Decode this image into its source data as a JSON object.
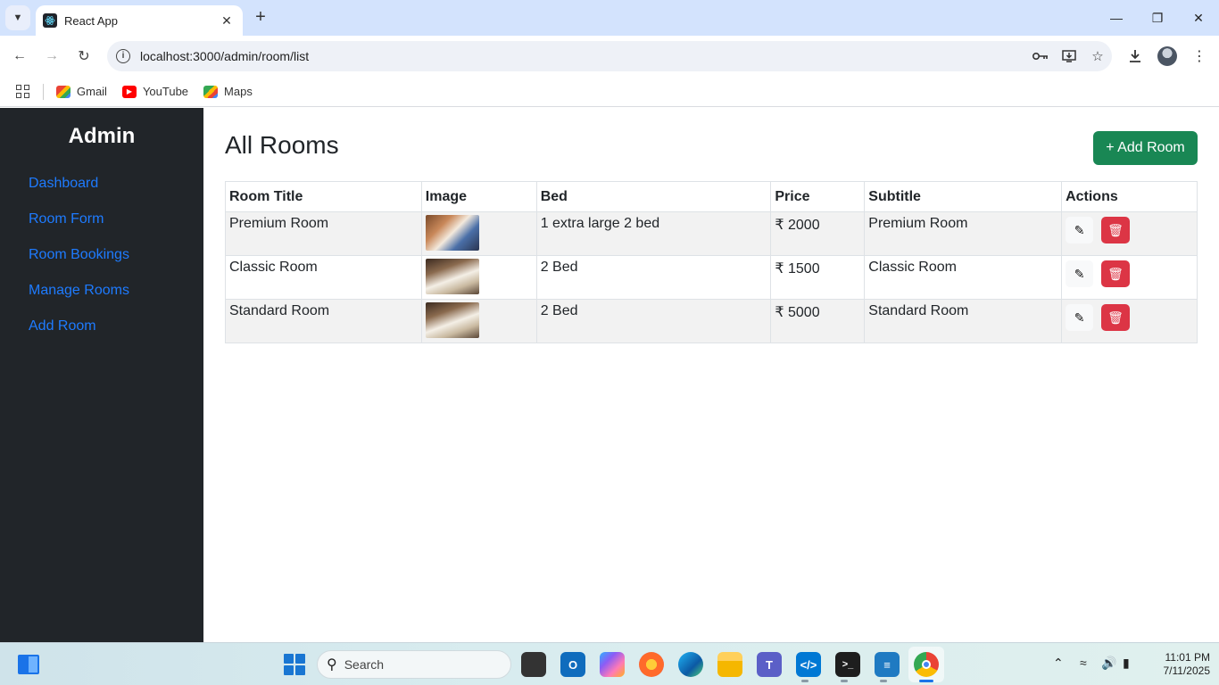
{
  "browser": {
    "tab_title": "React App",
    "url": "localhost:3000/admin/room/list",
    "bookmarks": [
      {
        "label": "Gmail",
        "icon": "gmail-icon",
        "color": "#ea4335"
      },
      {
        "label": "YouTube",
        "icon": "youtube-icon",
        "color": "#ff0000"
      },
      {
        "label": "Maps",
        "icon": "maps-icon",
        "color": "#34a853"
      }
    ]
  },
  "sidebar": {
    "title": "Admin",
    "items": [
      {
        "label": "Dashboard"
      },
      {
        "label": "Room Form"
      },
      {
        "label": "Room Bookings"
      },
      {
        "label": "Manage Rooms"
      },
      {
        "label": "Add Room"
      }
    ]
  },
  "main": {
    "heading": "All Rooms",
    "add_button": "+ Add Room",
    "columns": [
      "Room Title",
      "Image",
      "Bed",
      "Price",
      "Subtitle",
      "Actions"
    ],
    "rows": [
      {
        "title": "Premium Room",
        "bed": "1 extra large 2 bed",
        "price": "₹ 2000",
        "subtitle": "Premium Room"
      },
      {
        "title": "Classic Room",
        "bed": "2 Bed",
        "price": "₹ 1500",
        "subtitle": "Classic Room"
      },
      {
        "title": "Standard Room",
        "bed": "2 Bed",
        "price": "₹ 5000",
        "subtitle": "Standard Room"
      }
    ]
  },
  "taskbar": {
    "search_placeholder": "Search",
    "time": "11:01 PM",
    "date": "7/11/2025"
  },
  "colors": {
    "sidebar_bg": "#212529",
    "link": "#1e7bff",
    "add_button": "#198754",
    "delete_button": "#dc3545"
  }
}
